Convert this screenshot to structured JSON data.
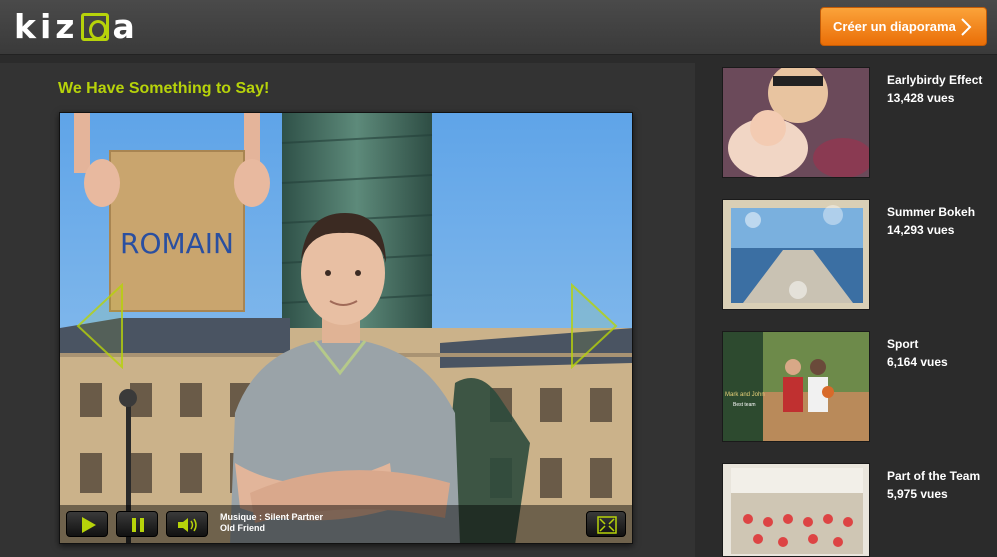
{
  "header": {
    "logo_text": "kizoa",
    "cta_label": "Créer un diaporama"
  },
  "main": {
    "title": "We Have Something to Say!",
    "slide": {
      "sign_text": "ROMAIN"
    },
    "player": {
      "music_line1": "Musique : Silent Partner",
      "music_line2": "Old Friend"
    }
  },
  "sidebar": {
    "items": [
      {
        "title": "Earlybirdy Effect",
        "views": "13,428 vues"
      },
      {
        "title": "Summer Bokeh",
        "views": "14,293 vues"
      },
      {
        "title": "Sport",
        "views": "6,164 vues"
      },
      {
        "title": "Part of the Team",
        "views": "5,975 vues"
      }
    ],
    "thumb3_text_a": "Mark and John",
    "thumb3_text_b": "Best team"
  },
  "colors": {
    "accent_green": "#b7d30a",
    "cta_orange": "#f08a1f",
    "background": "#2b2b2b"
  }
}
